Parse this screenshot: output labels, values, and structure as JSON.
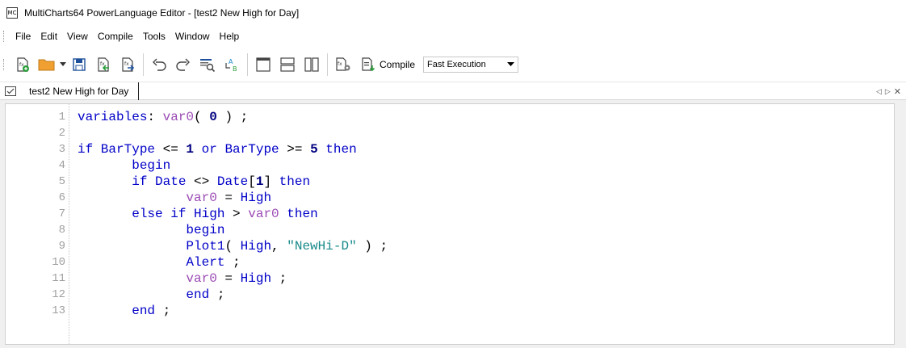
{
  "window": {
    "title": "MultiCharts64 PowerLanguage Editor - [test2 New High for Day]",
    "app_icon_text": "MC"
  },
  "menu": [
    "File",
    "Edit",
    "View",
    "Compile",
    "Tools",
    "Window",
    "Help"
  ],
  "toolbar": {
    "compile_label": "Compile",
    "mode_value": "Fast Execution"
  },
  "tab": {
    "label": "test2 New High for Day"
  },
  "editor": {
    "line_numbers": [
      "1",
      "2",
      "3",
      "4",
      "5",
      "6",
      "7",
      "8",
      "9",
      "10",
      "11",
      "12",
      "13"
    ],
    "lines": [
      [
        {
          "t": "kw",
          "v": "variables"
        },
        {
          "t": "op",
          "v": ": "
        },
        {
          "t": "var",
          "v": "var0"
        },
        {
          "t": "op",
          "v": "( "
        },
        {
          "t": "num",
          "v": "0"
        },
        {
          "t": "op",
          "v": " ) ;"
        }
      ],
      [],
      [
        {
          "t": "kw",
          "v": "if BarType"
        },
        {
          "t": "op",
          "v": " <= "
        },
        {
          "t": "num",
          "v": "1"
        },
        {
          "t": "kw",
          "v": " or BarType"
        },
        {
          "t": "op",
          "v": " >= "
        },
        {
          "t": "num",
          "v": "5"
        },
        {
          "t": "kw",
          "v": " then"
        }
      ],
      [
        {
          "t": "op",
          "v": "       "
        },
        {
          "t": "kw",
          "v": "begin"
        }
      ],
      [
        {
          "t": "op",
          "v": "       "
        },
        {
          "t": "kw",
          "v": "if Date"
        },
        {
          "t": "op",
          "v": " <> "
        },
        {
          "t": "kw",
          "v": "Date"
        },
        {
          "t": "op",
          "v": "["
        },
        {
          "t": "num",
          "v": "1"
        },
        {
          "t": "op",
          "v": "] "
        },
        {
          "t": "kw",
          "v": "then"
        }
      ],
      [
        {
          "t": "op",
          "v": "              "
        },
        {
          "t": "var",
          "v": "var0"
        },
        {
          "t": "op",
          "v": " = "
        },
        {
          "t": "kw",
          "v": "High"
        }
      ],
      [
        {
          "t": "op",
          "v": "       "
        },
        {
          "t": "kw",
          "v": "else if High"
        },
        {
          "t": "op",
          "v": " > "
        },
        {
          "t": "var",
          "v": "var0"
        },
        {
          "t": "kw",
          "v": " then"
        }
      ],
      [
        {
          "t": "op",
          "v": "              "
        },
        {
          "t": "kw",
          "v": "begin"
        }
      ],
      [
        {
          "t": "op",
          "v": "              "
        },
        {
          "t": "kw",
          "v": "Plot1"
        },
        {
          "t": "op",
          "v": "( "
        },
        {
          "t": "kw",
          "v": "High"
        },
        {
          "t": "op",
          "v": ", "
        },
        {
          "t": "str",
          "v": "\"NewHi-D\""
        },
        {
          "t": "op",
          "v": " ) ;"
        }
      ],
      [
        {
          "t": "op",
          "v": "              "
        },
        {
          "t": "kw",
          "v": "Alert"
        },
        {
          "t": "op",
          "v": " ;"
        }
      ],
      [
        {
          "t": "op",
          "v": "              "
        },
        {
          "t": "var",
          "v": "var0"
        },
        {
          "t": "op",
          "v": " = "
        },
        {
          "t": "kw",
          "v": "High"
        },
        {
          "t": "op",
          "v": " ;"
        }
      ],
      [
        {
          "t": "op",
          "v": "              "
        },
        {
          "t": "kw",
          "v": "end"
        },
        {
          "t": "op",
          "v": " ;"
        }
      ],
      [
        {
          "t": "op",
          "v": "       "
        },
        {
          "t": "kw",
          "v": "end"
        },
        {
          "t": "op",
          "v": " ;"
        }
      ]
    ]
  },
  "colors": {
    "keyword": "#0000c8",
    "variable": "#9b4ab5",
    "number": "#000080",
    "string": "#1a8a8a",
    "line_number": "#a0a0a0"
  }
}
